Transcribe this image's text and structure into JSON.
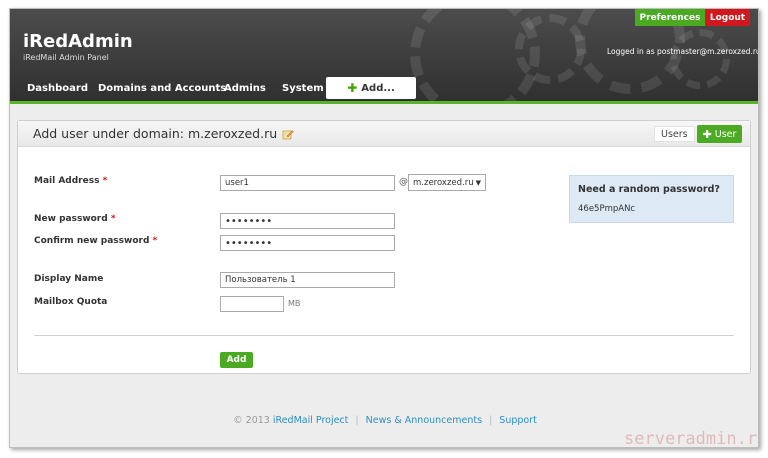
{
  "header": {
    "brand_title": "iRedAdmin",
    "brand_subtitle": "iRedMail Admin Panel",
    "preferences_label": "Preferences",
    "logout_label": "Logout",
    "logged_in_text": "Logged in as postmaster@m.zeroxzed.ru",
    "nav": [
      {
        "label": "Dashboard"
      },
      {
        "label": "Domains and Accounts"
      },
      {
        "label": "Admins"
      },
      {
        "label": "System"
      }
    ],
    "add_label": "Add...",
    "colors": {
      "accent_green": "#4caa22",
      "logout_red": "#d0181e",
      "nav_bar_green": "#58b529"
    }
  },
  "panel": {
    "title": "Add user under domain: m.zeroxzed.ru",
    "tab_users": "Users",
    "tab_user": "User",
    "form": {
      "mail_label": "Mail Address",
      "mail_value": "user1",
      "at_symbol": "@",
      "domain_value": "m.zeroxzed.ru",
      "new_password_label": "New password",
      "new_password_value": "••••••••",
      "confirm_password_label": "Confirm new password",
      "confirm_password_value": "••••••••",
      "display_name_label": "Display Name",
      "display_name_value": "Пользователь 1",
      "quota_label": "Mailbox Quota",
      "quota_value": "",
      "quota_unit": "MB",
      "required_mark": "*",
      "add_button": "Add"
    },
    "random_password": {
      "title": "Need a random password?",
      "value": "46e5PmpANc"
    }
  },
  "footer": {
    "copyright": "© 2013",
    "project_link": "iRedMail Project",
    "news_link": "News & Announcements",
    "support_link": "Support",
    "separator": "|"
  },
  "watermark": "serveradmin.ru"
}
